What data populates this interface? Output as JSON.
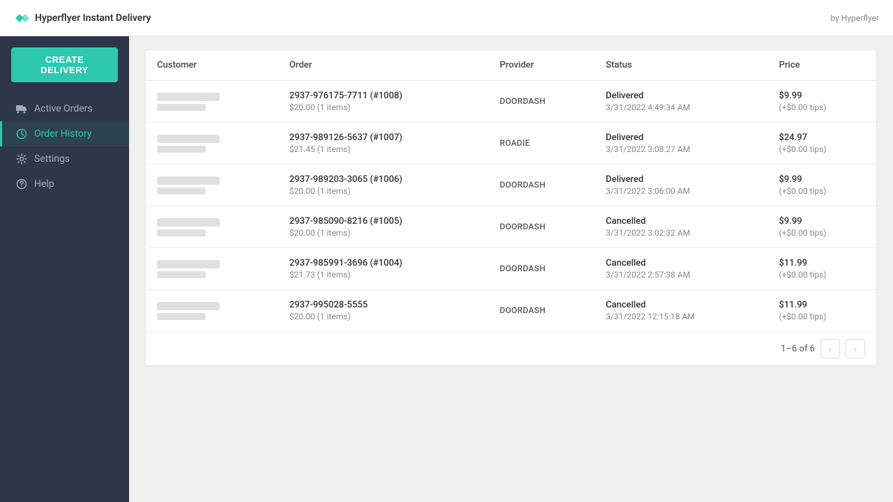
{
  "topbar": {
    "logo_text": "Hyperflyer Instant Delivery",
    "by_text": "by Hyperflyer"
  },
  "sidebar": {
    "create_button_label": "CREATE DELIVERY",
    "nav_items": [
      {
        "id": "active-orders",
        "label": "Active Orders",
        "icon": "truck",
        "active": false
      },
      {
        "id": "order-history",
        "label": "Order History",
        "icon": "clock",
        "active": true
      },
      {
        "id": "settings",
        "label": "Settings",
        "icon": "gear",
        "active": false
      },
      {
        "id": "help",
        "label": "Help",
        "icon": "question",
        "active": false
      }
    ]
  },
  "table": {
    "columns": [
      "Customer",
      "Order",
      "Provider",
      "Status",
      "Price"
    ],
    "rows": [
      {
        "order_id": "2937-976175-7711 (#1008)",
        "order_amount": "$20.00 (1 items)",
        "provider": "DOORDASH",
        "status_label": "Delivered",
        "status_date": "3/31/2022 4:49:34 AM",
        "price_main": "$9.99",
        "price_tips": "(+$0.00 tips)"
      },
      {
        "order_id": "2937-989126-5637 (#1007)",
        "order_amount": "$21.45 (1 items)",
        "provider": "ROADIE",
        "status_label": "Delivered",
        "status_date": "3/31/2022 3:08:27 AM",
        "price_main": "$24.97",
        "price_tips": "(+$0.00 tips)"
      },
      {
        "order_id": "2937-989203-3065 (#1006)",
        "order_amount": "$20.00 (1 items)",
        "provider": "DOORDASH",
        "status_label": "Delivered",
        "status_date": "3/31/2022 3:06:00 AM",
        "price_main": "$9.99",
        "price_tips": "(+$0.00 tips)"
      },
      {
        "order_id": "2937-985090-8216 (#1005)",
        "order_amount": "$20.00 (1 items)",
        "provider": "DOORDASH",
        "status_label": "Cancelled",
        "status_date": "3/31/2022 3:02:32 AM",
        "price_main": "$9.99",
        "price_tips": "(+$0.00 tips)"
      },
      {
        "order_id": "2937-985991-3696 (#1004)",
        "order_amount": "$21.73 (1 items)",
        "provider": "DOORDASH",
        "status_label": "Cancelled",
        "status_date": "3/31/2022 2:57:38 AM",
        "price_main": "$11.99",
        "price_tips": "(+$0.00 tips)"
      },
      {
        "order_id": "2937-995028-5555",
        "order_amount": "$20.00 (1 items)",
        "provider": "DOORDASH",
        "status_label": "Cancelled",
        "status_date": "3/31/2022 12:15:18 AM",
        "price_main": "$11.99",
        "price_tips": "(+$0.00 tips)"
      }
    ],
    "pagination": {
      "label": "1–6 of 6",
      "prev_disabled": true,
      "next_disabled": true
    }
  }
}
